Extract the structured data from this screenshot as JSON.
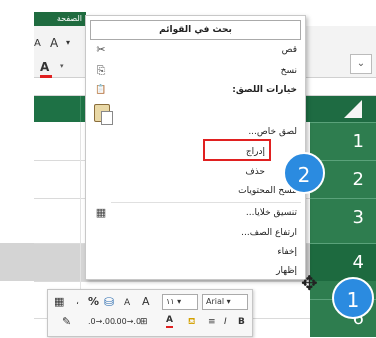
{
  "ribbon": {
    "title_fragment": "الصفحة",
    "font_grow_label": "A",
    "font_shrink_label": "A",
    "font_color_label": "A",
    "dropdown_glyph": "▾",
    "expand_glyph": "⌄"
  },
  "rows": [
    {
      "num": "1",
      "selected": false
    },
    {
      "num": "2",
      "selected": false
    },
    {
      "num": "3",
      "selected": false
    },
    {
      "num": "4",
      "selected": true
    },
    {
      "num": "6",
      "selected": false
    }
  ],
  "menu": {
    "search_label": "بحث في القوائم",
    "items": [
      {
        "label": "قص",
        "icon": "✂",
        "icon_name": "scissors-icon"
      },
      {
        "label": "نسخ",
        "icon": "⎘",
        "icon_name": "copy-icon"
      },
      {
        "label": "خيارات اللصق:",
        "icon": "📋",
        "icon_name": "paste-icon",
        "strong": true
      },
      {
        "label": "لصق خاص...",
        "icon": "",
        "icon_name": ""
      },
      {
        "label": "إدراج",
        "icon": "",
        "icon_name": "",
        "highlighted": true
      },
      {
        "label": "حذف",
        "icon": "",
        "icon_name": ""
      },
      {
        "label": "مسح المحتويات",
        "icon": "",
        "icon_name": ""
      },
      {
        "label": "تنسيق خلايا...",
        "icon": "▦",
        "icon_name": "format-cells-icon"
      },
      {
        "label": "ارتفاع الصف...",
        "icon": "",
        "icon_name": ""
      },
      {
        "label": "إخفاء",
        "icon": "",
        "icon_name": ""
      },
      {
        "label": "إظهار",
        "icon": "",
        "icon_name": ""
      }
    ]
  },
  "callouts": {
    "step1": "1",
    "step2": "2"
  },
  "mini_toolbar": {
    "font_name": "Arial",
    "font_size": "١١",
    "bold": "B",
    "italic": "I",
    "percent": "%",
    "comma": "،",
    "grow": "A",
    "shrink": "A",
    "font_color": "A",
    "dropdown_glyph": "▾"
  },
  "colors": {
    "excel_green": "#1e7145",
    "row_header_green": "#2e7d4f",
    "callout_blue": "#2b8be0",
    "highlight_red": "#e02020"
  }
}
